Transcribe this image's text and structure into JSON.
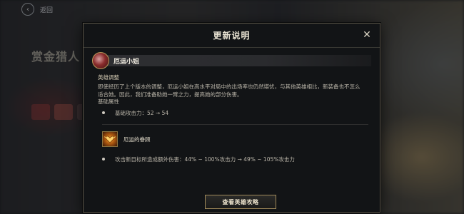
{
  "background": {
    "back_label": "返回",
    "title": "赏金猎人"
  },
  "dialog": {
    "title": "更新说明",
    "close_symbol": "✕"
  },
  "hero": {
    "name": "厄运小姐",
    "section_label": "英雄调整",
    "description": "即使经历了上个版本的调整，厄运小姐在高水平对局中的出场率也仍然堪忧，与其他英雄相比，新装备也不怎么适合她。因此，我们准备助她一臂之力，提高她的部分伤害。",
    "attr_label": "基础属性",
    "stat_change": "基础攻击力：52 → 54"
  },
  "item": {
    "name": "厄运的眷顾",
    "icon": "heart-crest-icon",
    "effect": "攻击新目标所造成额外伤害：44% ~ 100%攻击力 → 49% ~ 105%攻击力"
  },
  "footer": {
    "guide_button": "查看英雄攻略"
  },
  "colors": {
    "frame_gold": "#a08a5a",
    "panel_bg": "#121416",
    "text_primary": "#e8e2d2",
    "text_body": "#b9b4a8"
  }
}
